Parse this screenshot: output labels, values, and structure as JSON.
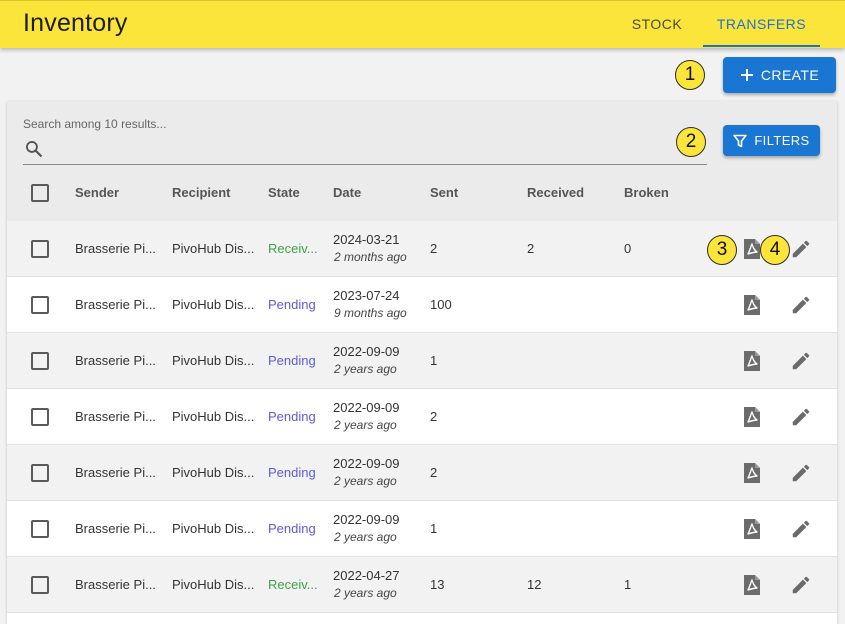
{
  "app": {
    "title": "Inventory"
  },
  "tabs": [
    {
      "label": "STOCK"
    },
    {
      "label": "TRANSFERS"
    }
  ],
  "toolbar": {
    "create_label": "CREATE",
    "filters_label": "FILTERS"
  },
  "search": {
    "label": "Search among 10 results...",
    "value": ""
  },
  "annotations": [
    "1",
    "2",
    "3",
    "4"
  ],
  "columns": [
    "Sender",
    "Recipient",
    "State",
    "Date",
    "Sent",
    "Received",
    "Broken"
  ],
  "rows": [
    {
      "sender": "Brasserie Pi...",
      "recipient": "PivoHub Dis...",
      "state": "Receiv...",
      "state_kind": "received",
      "date": "2024-03-21",
      "ago": "2 months ago",
      "sent": "2",
      "received": "2",
      "broken": "0"
    },
    {
      "sender": "Brasserie Pi...",
      "recipient": "PivoHub Dis...",
      "state": "Pending",
      "state_kind": "pending",
      "date": "2023-07-24",
      "ago": "9 months ago",
      "sent": "100",
      "received": "",
      "broken": ""
    },
    {
      "sender": "Brasserie Pi...",
      "recipient": "PivoHub Dis...",
      "state": "Pending",
      "state_kind": "pending",
      "date": "2022-09-09",
      "ago": "2 years ago",
      "sent": "1",
      "received": "",
      "broken": ""
    },
    {
      "sender": "Brasserie Pi...",
      "recipient": "PivoHub Dis...",
      "state": "Pending",
      "state_kind": "pending",
      "date": "2022-09-09",
      "ago": "2 years ago",
      "sent": "2",
      "received": "",
      "broken": ""
    },
    {
      "sender": "Brasserie Pi...",
      "recipient": "PivoHub Dis...",
      "state": "Pending",
      "state_kind": "pending",
      "date": "2022-09-09",
      "ago": "2 years ago",
      "sent": "2",
      "received": "",
      "broken": ""
    },
    {
      "sender": "Brasserie Pi...",
      "recipient": "PivoHub Dis...",
      "state": "Pending",
      "state_kind": "pending",
      "date": "2022-09-09",
      "ago": "2 years ago",
      "sent": "1",
      "received": "",
      "broken": ""
    },
    {
      "sender": "Brasserie Pi...",
      "recipient": "PivoHub Dis...",
      "state": "Receiv...",
      "state_kind": "received",
      "date": "2022-04-27",
      "ago": "2 years ago",
      "sent": "13",
      "received": "12",
      "broken": "1"
    }
  ],
  "icons": {
    "create": "plus-icon",
    "filters": "funnel-icon",
    "search": "search-icon",
    "download": "pdf-icon",
    "edit": "pencil-icon"
  },
  "colors": {
    "appbar": "#fbe53b",
    "primary": "#1976d2",
    "received": "#43a047",
    "pending": "#5c5bd8"
  }
}
